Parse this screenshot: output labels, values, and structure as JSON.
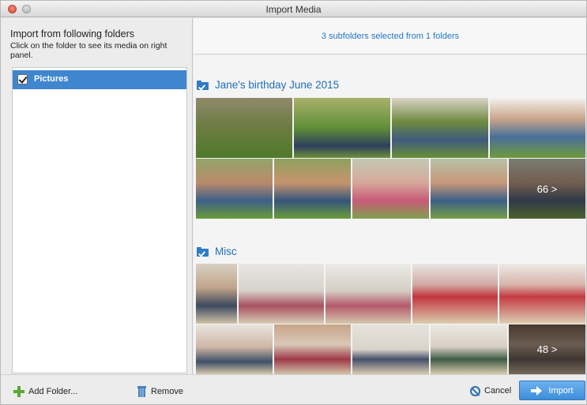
{
  "window": {
    "title": "Import Media"
  },
  "left_panel": {
    "heading": "Import from following folders",
    "subheading": "Click on the folder to see its media on right panel.",
    "folders": [
      {
        "label": "Pictures",
        "checked": true,
        "selected": true
      }
    ],
    "add_folder_label": "Add Folder...",
    "remove_label": "Remove"
  },
  "right_panel": {
    "summary": "3 subfolders selected from 1 folders",
    "groups": [
      {
        "title": "Jane's birthday June 2015",
        "checked": true,
        "more_label": "66 >"
      },
      {
        "title": "Misc",
        "checked": true,
        "more_label": "48 >"
      }
    ],
    "cancel_label": "Cancel",
    "import_label": "Import"
  },
  "colors": {
    "accent": "#3f86cf",
    "link_text": "#2478c8",
    "add_icon": "#59a833"
  }
}
